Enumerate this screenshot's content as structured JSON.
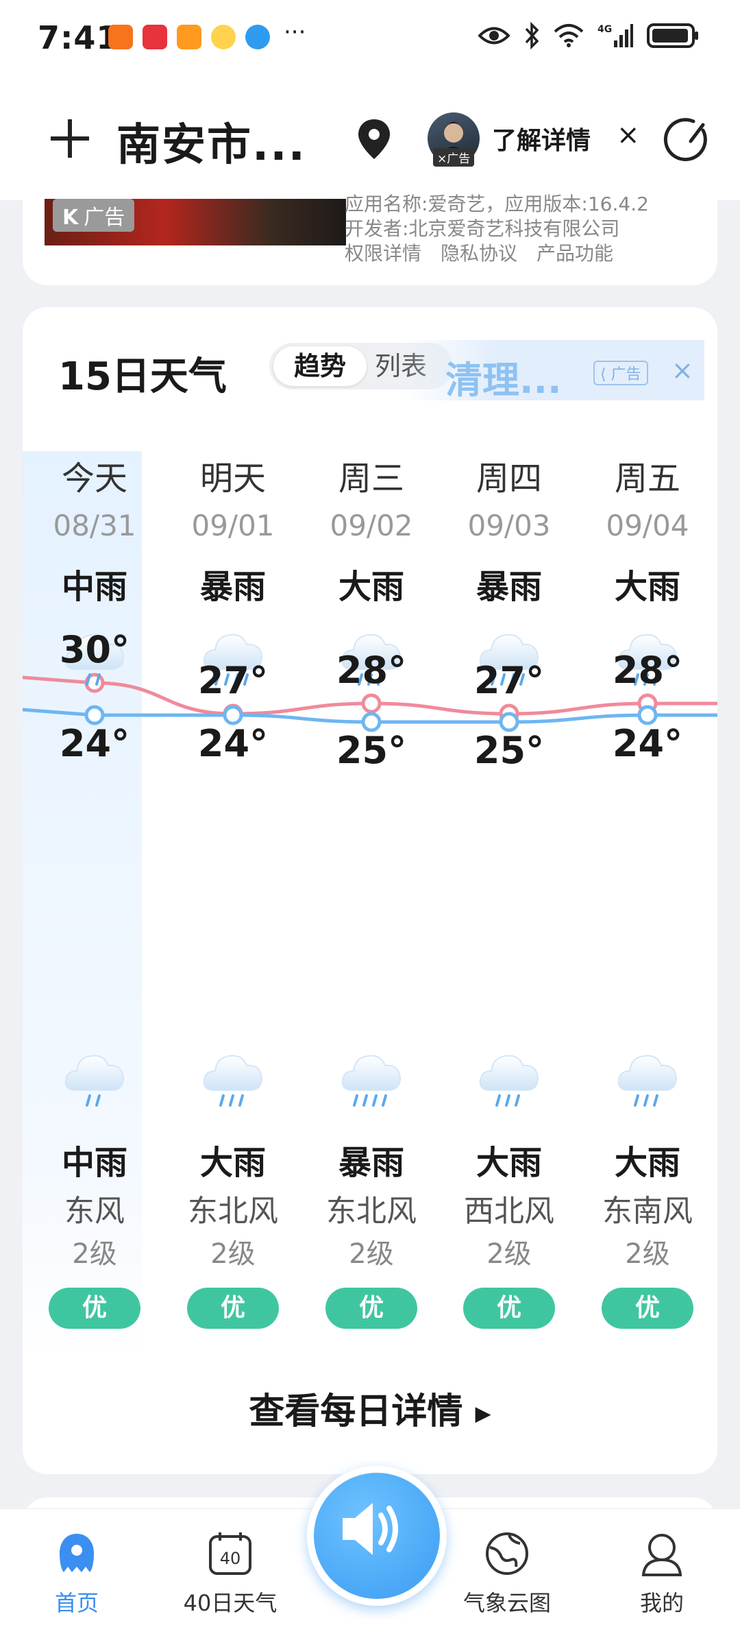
{
  "status_bar": {
    "time": "7:41",
    "more": "···"
  },
  "header": {
    "city": "南安市...",
    "ad_tag": "×广告",
    "detail_label": "了解详情",
    "close": "×"
  },
  "top_ad": {
    "image_tag": "广告",
    "lines": [
      "应用名称:爱奇艺，应用版本:16.4.2",
      "开发者:北京爱奇艺科技有限公司",
      "权限详情　隐私协议　产品功能"
    ]
  },
  "forecast": {
    "title": "15日天气",
    "toggle": {
      "active": "趋势",
      "inactive": "列表"
    },
    "ad_banner": {
      "text": "清理...",
      "tag": "广告",
      "close": "×"
    },
    "days": [
      {
        "day": "今天",
        "date": "08/31",
        "day_weather": "中雨",
        "day_icon": "moderate-rain-icon",
        "high": "30°",
        "low": "24°",
        "night_icon": "moderate-rain-icon",
        "night_weather": "中雨",
        "wind_dir": "东风",
        "wind_level": "2级",
        "aqi": "优"
      },
      {
        "day": "明天",
        "date": "09/01",
        "day_weather": "暴雨",
        "day_icon": "rainstorm-icon",
        "high": "27°",
        "low": "24°",
        "night_icon": "heavy-rain-icon",
        "night_weather": "大雨",
        "wind_dir": "东北风",
        "wind_level": "2级",
        "aqi": "优"
      },
      {
        "day": "周三",
        "date": "09/02",
        "day_weather": "大雨",
        "day_icon": "heavy-rain-icon",
        "high": "28°",
        "low": "25°",
        "night_icon": "rainstorm-icon",
        "night_weather": "暴雨",
        "wind_dir": "东北风",
        "wind_level": "2级",
        "aqi": "优"
      },
      {
        "day": "周四",
        "date": "09/03",
        "day_weather": "暴雨",
        "day_icon": "rainstorm-icon",
        "high": "27°",
        "low": "25°",
        "night_icon": "heavy-rain-icon",
        "night_weather": "大雨",
        "wind_dir": "西北风",
        "wind_level": "2级",
        "aqi": "优"
      },
      {
        "day": "周五",
        "date": "09/04",
        "day_weather": "大雨",
        "day_icon": "heavy-rain-icon",
        "high": "28°",
        "low": "24°",
        "night_icon": "heavy-rain-icon",
        "night_weather": "大雨",
        "wind_dir": "东南风",
        "wind_level": "2级",
        "aqi": "优"
      }
    ],
    "more_label": "查看每日详情",
    "colors": {
      "high_line": "#f08a9b",
      "low_line": "#6db6f2",
      "aqi_good": "#3fc6a0"
    }
  },
  "bottom_nav": [
    {
      "label": "首页",
      "icon": "home-icon",
      "active": true
    },
    {
      "label": "40日天气",
      "icon": "calendar-40-icon",
      "active": false
    },
    {
      "label": "气象云图",
      "icon": "globe-icon",
      "active": false
    },
    {
      "label": "我的",
      "icon": "profile-icon",
      "active": false
    }
  ],
  "calendar_icon_text": "40"
}
